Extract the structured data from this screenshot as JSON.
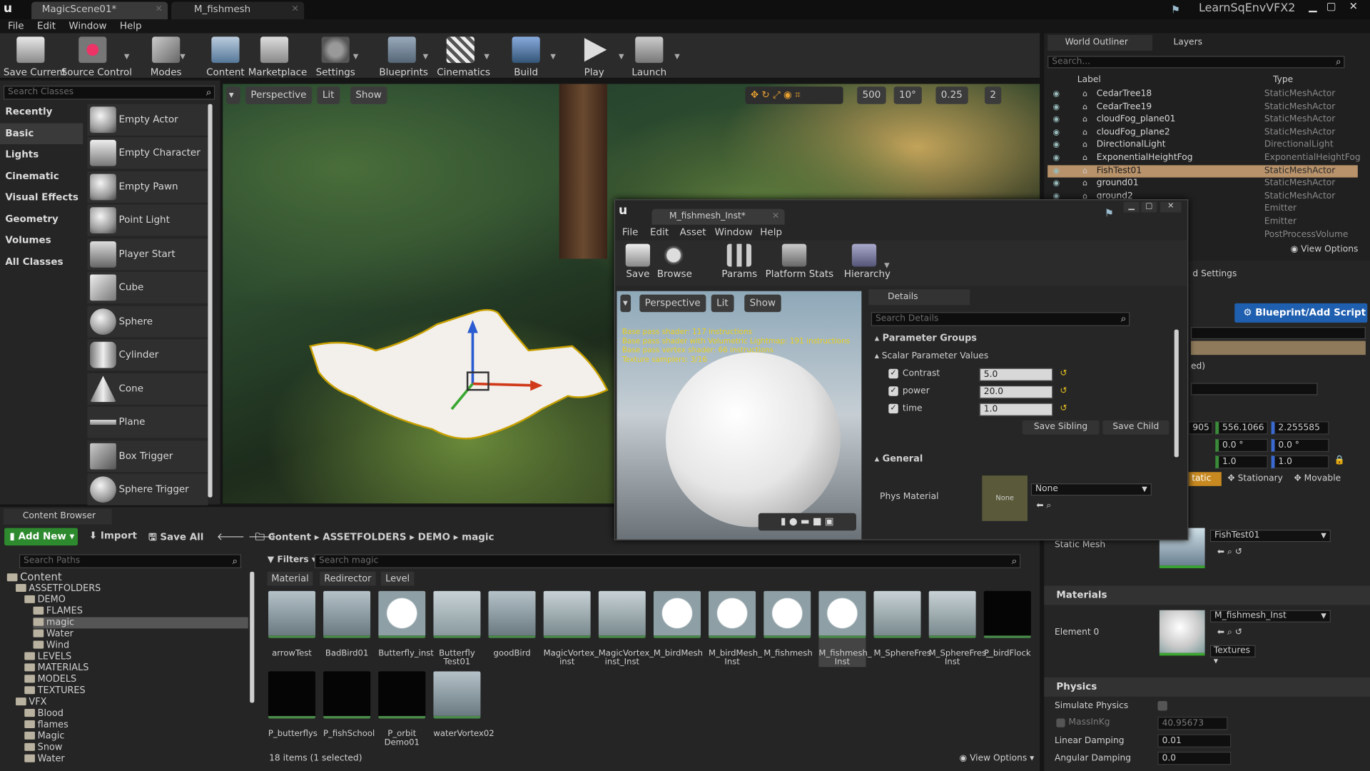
{
  "titlebar": {
    "tab1": "MagicScene01*",
    "tab2": "M_fishmesh",
    "project": "LearnSqEnvVFX2"
  },
  "menu": [
    "File",
    "Edit",
    "Window",
    "Help"
  ],
  "toolbar": [
    "Save Current",
    "Source Control",
    "Modes",
    "Content",
    "Marketplace",
    "Settings",
    "Blueprints",
    "Cinematics",
    "Build",
    "Play",
    "Launch"
  ],
  "modes": {
    "search_placeholder": "Search Classes",
    "categories": [
      "Recently Placed",
      "Basic",
      "Lights",
      "Cinematic",
      "Visual Effects",
      "Geometry",
      "Volumes",
      "All Classes"
    ],
    "items": [
      "Empty Actor",
      "Empty Character",
      "Empty Pawn",
      "Point Light",
      "Player Start",
      "Cube",
      "Sphere",
      "Cylinder",
      "Cone",
      "Plane",
      "Box Trigger",
      "Sphere Trigger"
    ]
  },
  "viewport": {
    "perspective": "Perspective",
    "lit": "Lit",
    "show": "Show",
    "grid": "500",
    "angle": "10°",
    "scale": "0.25",
    "speed": "2"
  },
  "outliner": {
    "tab1": "World Outliner",
    "tab2": "Layers",
    "search_placeholder": "Search...",
    "col_label": "Label",
    "col_type": "Type",
    "rows": [
      {
        "label": "CedarTree18",
        "type": "StaticMeshActor"
      },
      {
        "label": "CedarTree19",
        "type": "StaticMeshActor"
      },
      {
        "label": "cloudFog_plane01",
        "type": "StaticMeshActor"
      },
      {
        "label": "cloudFog_plane2",
        "type": "StaticMeshActor"
      },
      {
        "label": "DirectionalLight",
        "type": "DirectionalLight"
      },
      {
        "label": "ExponentialHeightFog",
        "type": "ExponentialHeightFog"
      },
      {
        "label": "FishTest01",
        "type": "StaticMeshActor"
      },
      {
        "label": "ground01",
        "type": "StaticMeshActor"
      },
      {
        "label": "ground2",
        "type": "StaticMeshActor"
      },
      {
        "label": "",
        "type": "Emitter"
      },
      {
        "label": "",
        "type": "Emitter"
      },
      {
        "label": "",
        "type": "PostProcessVolume"
      }
    ],
    "view_options": "View Options"
  },
  "details": {
    "tab_suffix": "d Settings",
    "blueprint_btn": "Blueprint/Add Script",
    "ed_text": "ed)",
    "loc_x": "905",
    "loc_y": "556.1066",
    "loc_z": "2.255585",
    "rot_y": "0.0 °",
    "rot_z": "0.0 °",
    "scale_y": "1.0",
    "scale_z": "1.0",
    "mobility_static": "tatic",
    "mobility_stationary": "Stationary",
    "mobility_movable": "Movable",
    "static_mesh_label": "Static Mesh",
    "static_mesh_value": "FishTest01",
    "materials_section": "Materials",
    "element_label": "Element 0",
    "material_value": "M_fishmesh_Inst",
    "textures_btn": "Textures",
    "physics_section": "Physics",
    "simulate": "Simulate Physics",
    "mass_label": "MassInKg",
    "mass_value": "40.95673",
    "linear_label": "Linear Damping",
    "linear_value": "0.01",
    "angular_label": "Angular Damping",
    "angular_value": "0.0"
  },
  "material_editor": {
    "tab": "M_fishmesh_Inst*",
    "menu": [
      "File",
      "Edit",
      "Asset",
      "Window",
      "Help"
    ],
    "toolbar": [
      "Save",
      "Browse",
      "Params",
      "Platform Stats",
      "Hierarchy"
    ],
    "vp_perspective": "Perspective",
    "vp_lit": "Lit",
    "vp_show": "Show",
    "stats": [
      "Base pass shader: 117 instructions",
      "Base pass shader with Volumetric Lightmap: 191 instructions",
      "Base pass vertex shader: 66 instructions",
      "Texture samplers: 3/16"
    ],
    "details_tab": "Details",
    "search_placeholder": "Search Details",
    "parameter_groups": "Parameter Groups",
    "scalar_values": "Scalar Parameter Values",
    "params": [
      {
        "name": "Contrast",
        "value": "5.0"
      },
      {
        "name": "power",
        "value": "20.0"
      },
      {
        "name": "time",
        "value": "1.0"
      }
    ],
    "save_sibling": "Save Sibling",
    "save_child": "Save Child",
    "general": "General",
    "phys_material": "Phys Material",
    "phys_thumb": "None",
    "phys_value": "None"
  },
  "content_browser": {
    "tab": "Content Browser",
    "add_new": "Add New",
    "import": "Import",
    "save_all": "Save All",
    "breadcrumb": [
      "Content",
      "ASSETFOLDERS",
      "DEMO",
      "magic"
    ],
    "search_paths": "Search Paths",
    "filters": "Filters",
    "search_placeholder": "Search magic",
    "filter_tabs": [
      "Material",
      "Redirector",
      "Level"
    ],
    "tree": [
      "Content",
      "ASSETFOLDERS",
      "DEMO",
      "FLAMES",
      "magic",
      "Water",
      "Wind",
      "LEVELS",
      "MATERIALS",
      "MODELS",
      "TEXTURES",
      "VFX",
      "Blood",
      "flames",
      "Magic",
      "Snow",
      "Water"
    ],
    "assets": [
      "arrowTest",
      "BadBird01",
      "Butterfly_inst",
      "Butterfly Test01",
      "goodBird",
      "MagicVortex_ inst",
      "MagicVortex_ inst_Inst",
      "M_birdMesh",
      "M_birdMesh_ Inst",
      "M_fishmesh",
      "M_fishmesh_ Inst",
      "M_SphereFres",
      "M_SphereFres_ Inst",
      "P_birdFlock",
      "P_butterflys",
      "P_fishSchool",
      "P_orbit Demo01",
      "waterVortex02"
    ],
    "status": "18 items (1 selected)",
    "view_options": "View Options"
  }
}
